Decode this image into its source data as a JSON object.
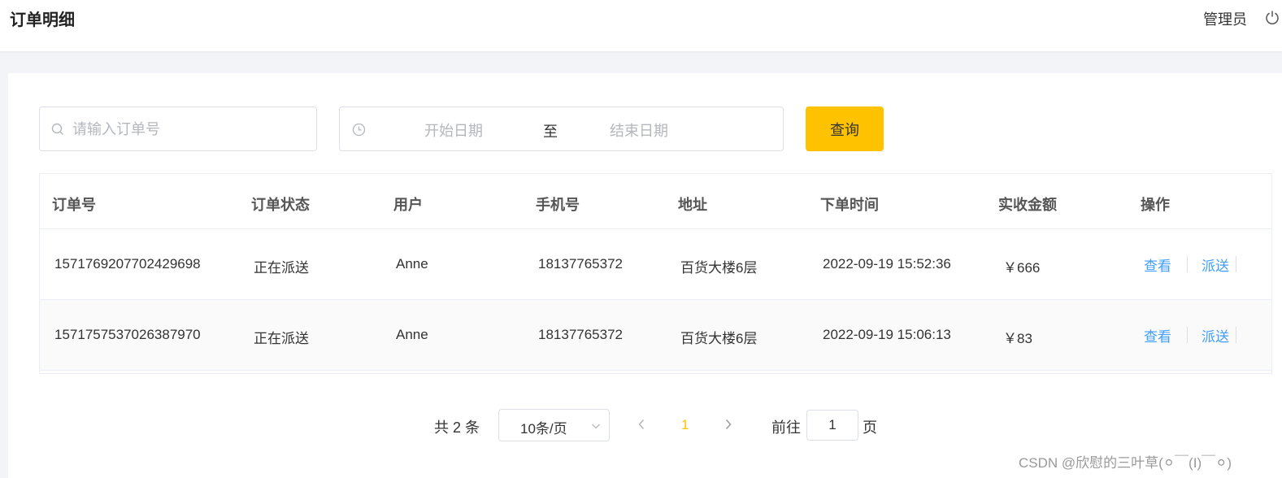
{
  "header": {
    "title": "订单明细",
    "user": "管理员"
  },
  "filters": {
    "order_placeholder": "请输入订单号",
    "start_placeholder": "开始日期",
    "range_separator": "至",
    "end_placeholder": "结束日期",
    "query_label": "查询"
  },
  "table": {
    "columns": [
      "订单号",
      "订单状态",
      "用户",
      "手机号",
      "地址",
      "下单时间",
      "实收金额",
      "操作"
    ],
    "rows": [
      {
        "order_no": "1571769207702429698",
        "status": "正在派送",
        "user": "Anne",
        "phone": "18137765372",
        "address": "百货大楼6层",
        "time": "2022-09-19 15:52:36",
        "amount": "￥666",
        "view": "查看",
        "dispatch": "派送"
      },
      {
        "order_no": "1571757537026387970",
        "status": "正在派送",
        "user": "Anne",
        "phone": "18137765372",
        "address": "百货大楼6层",
        "time": "2022-09-19 15:06:13",
        "amount": "￥83",
        "view": "查看",
        "dispatch": "派送"
      }
    ]
  },
  "pagination": {
    "total": "共 2 条",
    "page_size": "10条/页",
    "current_page": "1",
    "goto_label": "前往",
    "goto_value": "1",
    "page_suffix": "页"
  },
  "watermark": "CSDN @欣慰的三叶草(⚪￣(I)￣⚪)",
  "colors": {
    "accent": "#ffc200",
    "link": "#419eff",
    "background": "#f3f4f7"
  }
}
